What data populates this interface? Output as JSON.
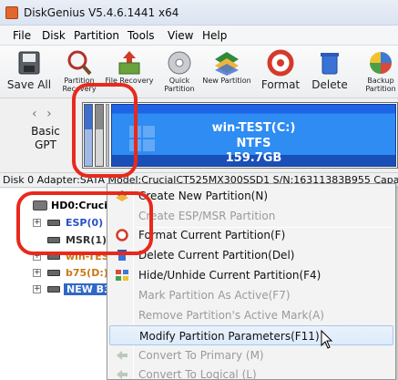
{
  "window": {
    "title": "DiskGenius V5.4.6.1441 x64"
  },
  "menu": {
    "items": [
      "File",
      "Disk",
      "Partition",
      "Tools",
      "View",
      "Help"
    ]
  },
  "toolbar": {
    "buttons": [
      {
        "label": "Save All",
        "icon": "save-disk-icon"
      },
      {
        "label": "Partition Recovery",
        "icon": "magnifier-icon"
      },
      {
        "label": "File Recovery",
        "icon": "file-recovery-icon"
      },
      {
        "label": "Quick Partition",
        "icon": "quick-partition-icon"
      },
      {
        "label": "New Partition",
        "icon": "new-partition-icon"
      },
      {
        "label": "Format",
        "icon": "format-icon"
      },
      {
        "label": "Delete",
        "icon": "delete-icon"
      },
      {
        "label": "Backup Partition",
        "icon": "backup-icon"
      }
    ]
  },
  "diskmap": {
    "type_label": "Basic\nGPT",
    "main_partition": {
      "name": "win-TEST(C:)",
      "fs": "NTFS",
      "size": "159.7GB"
    }
  },
  "disk_info": "Disk 0 Adapter:SATA  Model:CrucialCT525MX300SSD1  S/N:16311383B955  Capac",
  "tree": {
    "disk": "HD0:Crucial",
    "partitions": [
      {
        "label": "ESP(0)",
        "color": "#2850c8"
      },
      {
        "label": "MSR(1)",
        "color": "#333333"
      },
      {
        "label": "win-TES",
        "color": "#c87818"
      },
      {
        "label": "b75(D:)",
        "color": "#c87818"
      },
      {
        "label": "NEW B3",
        "color": "#ffffff",
        "selected": true
      }
    ]
  },
  "context_menu": {
    "items": [
      {
        "label": "Create New Partition(N)",
        "enabled": true,
        "icon": "new-partition-icon"
      },
      {
        "label": "Create ESP/MSR Partition",
        "enabled": false,
        "icon": ""
      },
      {
        "label": "Format Current Partition(F)",
        "enabled": true,
        "icon": "format-icon"
      },
      {
        "label": "Delete Current Partition(Del)",
        "enabled": true,
        "icon": "delete-icon"
      },
      {
        "label": "Hide/Unhide Current Partition(F4)",
        "enabled": true,
        "icon": "hide-unhide-icon"
      },
      {
        "label": "Mark Partition As Active(F7)",
        "enabled": false,
        "icon": ""
      },
      {
        "label": "Remove Partition's Active Mark(A)",
        "enabled": false,
        "icon": ""
      },
      {
        "label": "Modify Partition Parameters(F11)",
        "enabled": true,
        "highlight": true,
        "icon": ""
      },
      {
        "label": "Convert To Primary (M)",
        "enabled": false,
        "icon": "convert-icon"
      },
      {
        "label": "Convert To Logical (L)",
        "enabled": false,
        "icon": "convert-icon"
      }
    ]
  },
  "colors": {
    "annotation": "#e8291c",
    "partition_blue": "#2e8cf2",
    "selection": "#3068c8"
  }
}
